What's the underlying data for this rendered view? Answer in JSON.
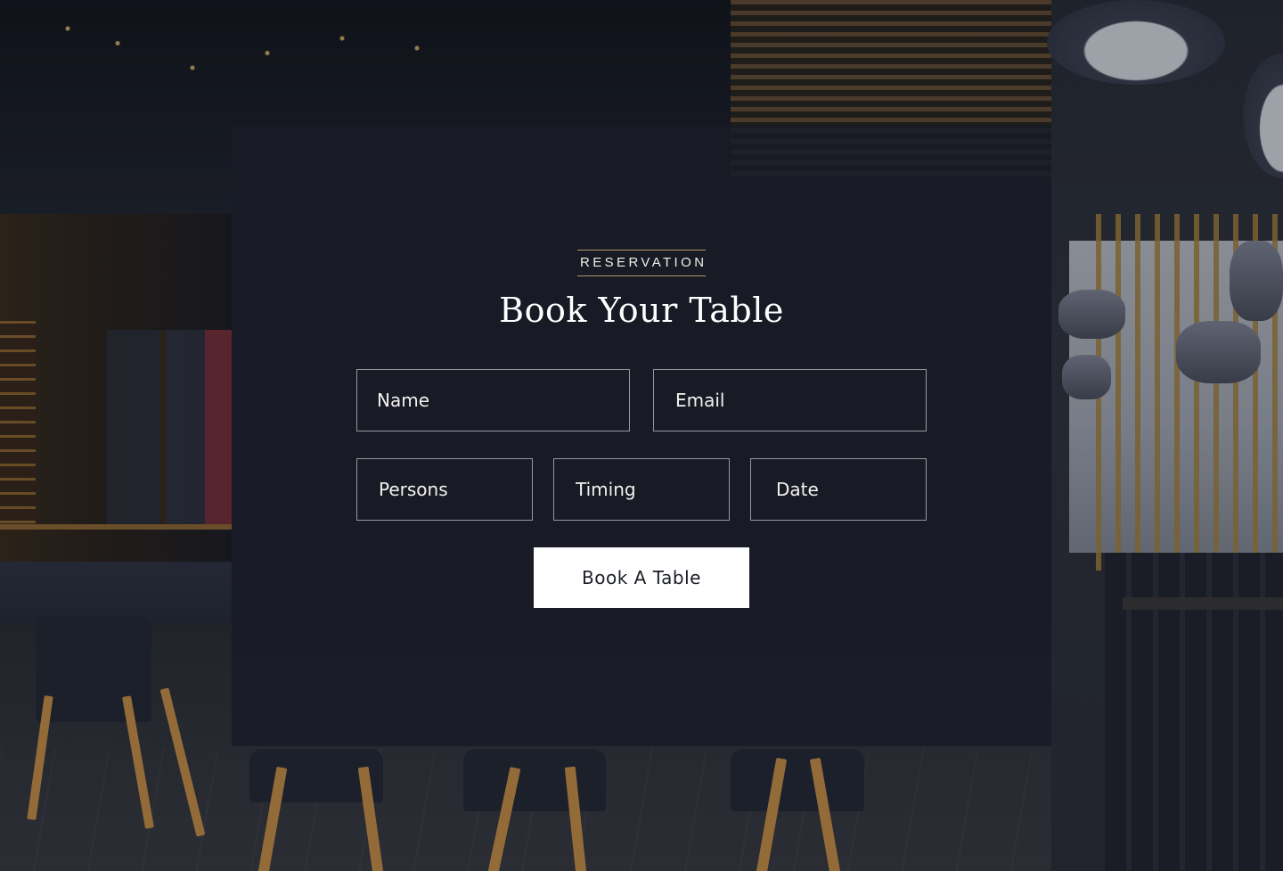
{
  "reservation": {
    "eyebrow": "RESERVATION",
    "title": "Book Your Table",
    "fields": {
      "name_placeholder": "Name",
      "email_placeholder": "Email",
      "persons_placeholder": "Persons",
      "timing_placeholder": "Timing",
      "date_placeholder": "Date"
    },
    "submit_label": "Book A Table"
  },
  "colors": {
    "panel_background": "#181b26",
    "accent_line": "#b8956a",
    "button_background": "#ffffff",
    "button_text": "#1b1e27",
    "text_primary": "#ffffff"
  }
}
